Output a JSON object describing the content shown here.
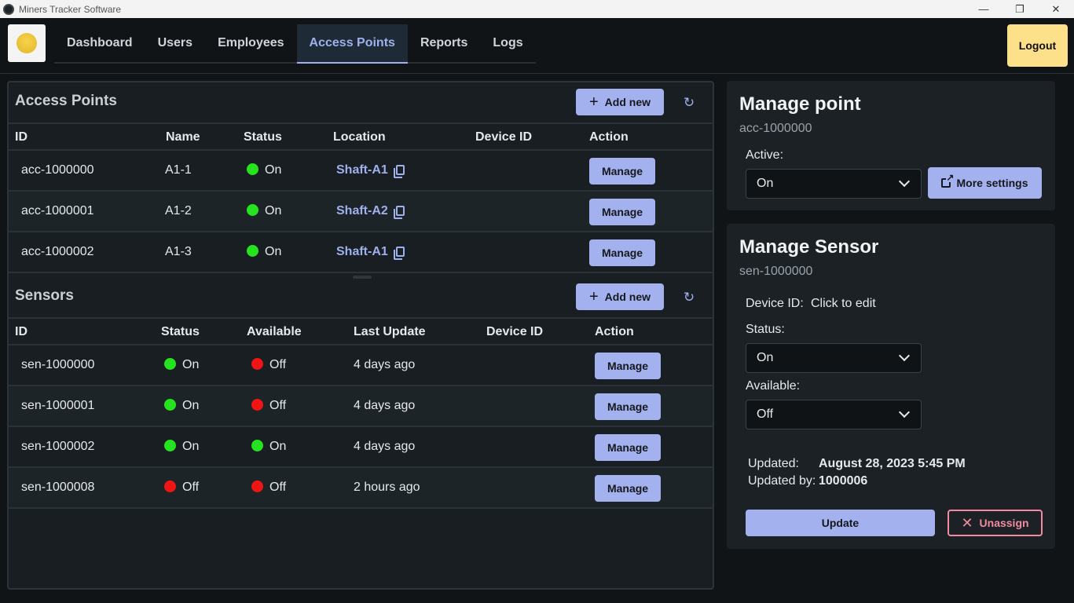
{
  "window": {
    "title": "Miners Tracker Software",
    "minimize": "—",
    "restore": "❐",
    "close": "✕"
  },
  "nav": {
    "tabs": [
      "Dashboard",
      "Users",
      "Employees",
      "Access Points",
      "Reports",
      "Logs"
    ],
    "active": "Access Points",
    "logout": "Logout"
  },
  "access_points": {
    "title": "Access Points",
    "add_label": "Add new",
    "columns": [
      "ID",
      "Name",
      "Status",
      "Location",
      "Device ID",
      "Action"
    ],
    "rows": [
      {
        "id": "acc-1000000",
        "name": "A1-1",
        "status": "On",
        "location": "Shaft-A1",
        "device_id": "",
        "action": "Manage"
      },
      {
        "id": "acc-1000001",
        "name": "A1-2",
        "status": "On",
        "location": "Shaft-A2",
        "device_id": "",
        "action": "Manage"
      },
      {
        "id": "acc-1000002",
        "name": "A1-3",
        "status": "On",
        "location": "Shaft-A1",
        "device_id": "",
        "action": "Manage"
      }
    ]
  },
  "sensors": {
    "title": "Sensors",
    "add_label": "Add new",
    "columns": [
      "ID",
      "Status",
      "Available",
      "Last Update",
      "Device ID",
      "Action"
    ],
    "rows": [
      {
        "id": "sen-1000000",
        "status": "On",
        "available": "Off",
        "last_update": "4 days ago",
        "device_id": "",
        "action": "Manage"
      },
      {
        "id": "sen-1000001",
        "status": "On",
        "available": "Off",
        "last_update": "4 days ago",
        "device_id": "",
        "action": "Manage"
      },
      {
        "id": "sen-1000002",
        "status": "On",
        "available": "On",
        "last_update": "4 days ago",
        "device_id": "",
        "action": "Manage"
      },
      {
        "id": "sen-1000008",
        "status": "Off",
        "available": "Off",
        "last_update": "2 hours ago",
        "device_id": "",
        "action": "Manage"
      }
    ]
  },
  "manage_point": {
    "title": "Manage point",
    "id": "acc-1000000",
    "active_label": "Active:",
    "active_value": "On",
    "more_settings": "More settings"
  },
  "manage_sensor": {
    "title": "Manage Sensor",
    "id": "sen-1000000",
    "device_id_label": "Device ID:",
    "device_id_value": "Click to edit",
    "status_label": "Status:",
    "status_value": "On",
    "available_label": "Available:",
    "available_value": "Off",
    "updated_label": "Updated:",
    "updated_value": "August 28, 2023 5:45 PM",
    "updated_by_label": "Updated by:",
    "updated_by_value": "1000006",
    "update_button": "Update",
    "unassign_button": "Unassign"
  },
  "colors": {
    "accent": "#a3b1ee",
    "logout_bg": "#fde08a",
    "status_on": "#25e31e",
    "status_off": "#f01414",
    "danger": "#f28ba0"
  },
  "icons": {
    "plus": "plus-icon",
    "refresh": "refresh-icon",
    "copy": "copy-icon",
    "external": "external-link-icon",
    "chevron": "chevron-down-icon",
    "close": "close-icon"
  }
}
